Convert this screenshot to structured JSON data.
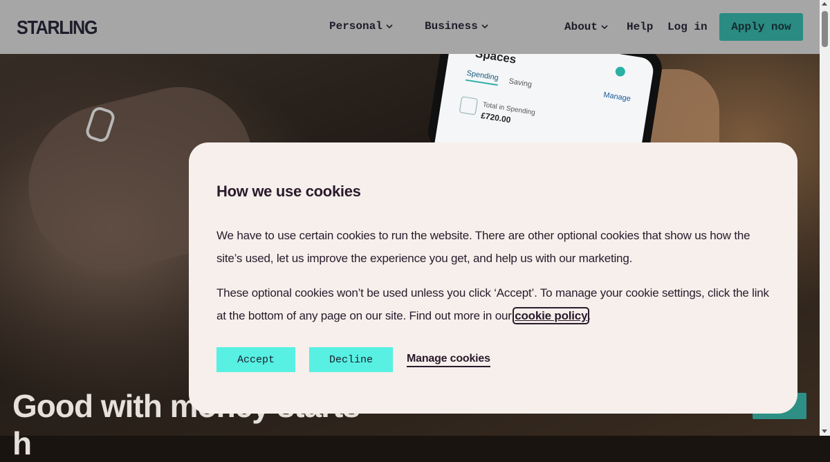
{
  "header": {
    "logo": "STARLING",
    "nav": {
      "personal": "Personal",
      "business": "Business",
      "about": "About",
      "help": "Help",
      "login": "Log in"
    },
    "apply_label": "Apply now"
  },
  "hero": {
    "heading": "Good with money starts",
    "heading_line2": "h",
    "phone": {
      "title": "Spaces",
      "tab_spending": "Spending",
      "tab_saving": "Saving",
      "manage": "Manage",
      "row_label": "Total in Spending",
      "row_amount": "£720.00"
    }
  },
  "cookie_modal": {
    "title": "How we use cookies",
    "paragraph1": "We have to use certain cookies to run the website. There are other optional cookies that show us how the site’s used, let us improve the experience you get, and help us with our marketing.",
    "paragraph2_before": "These optional cookies won’t be used unless you click ‘Accept’. To manage your cookie settings, click the link at the bottom of any page on our site. Find out more in our ",
    "paragraph2_link": "cookie policy",
    "paragraph2_after": ".",
    "accept_label": "Accept",
    "decline_label": "Decline",
    "manage_label": "Manage cookies"
  },
  "colors": {
    "accent": "#57f0e3",
    "brand_teal": "#2a8b82",
    "modal_bg": "#f6efeb",
    "text_dark": "#2a1a2c"
  }
}
